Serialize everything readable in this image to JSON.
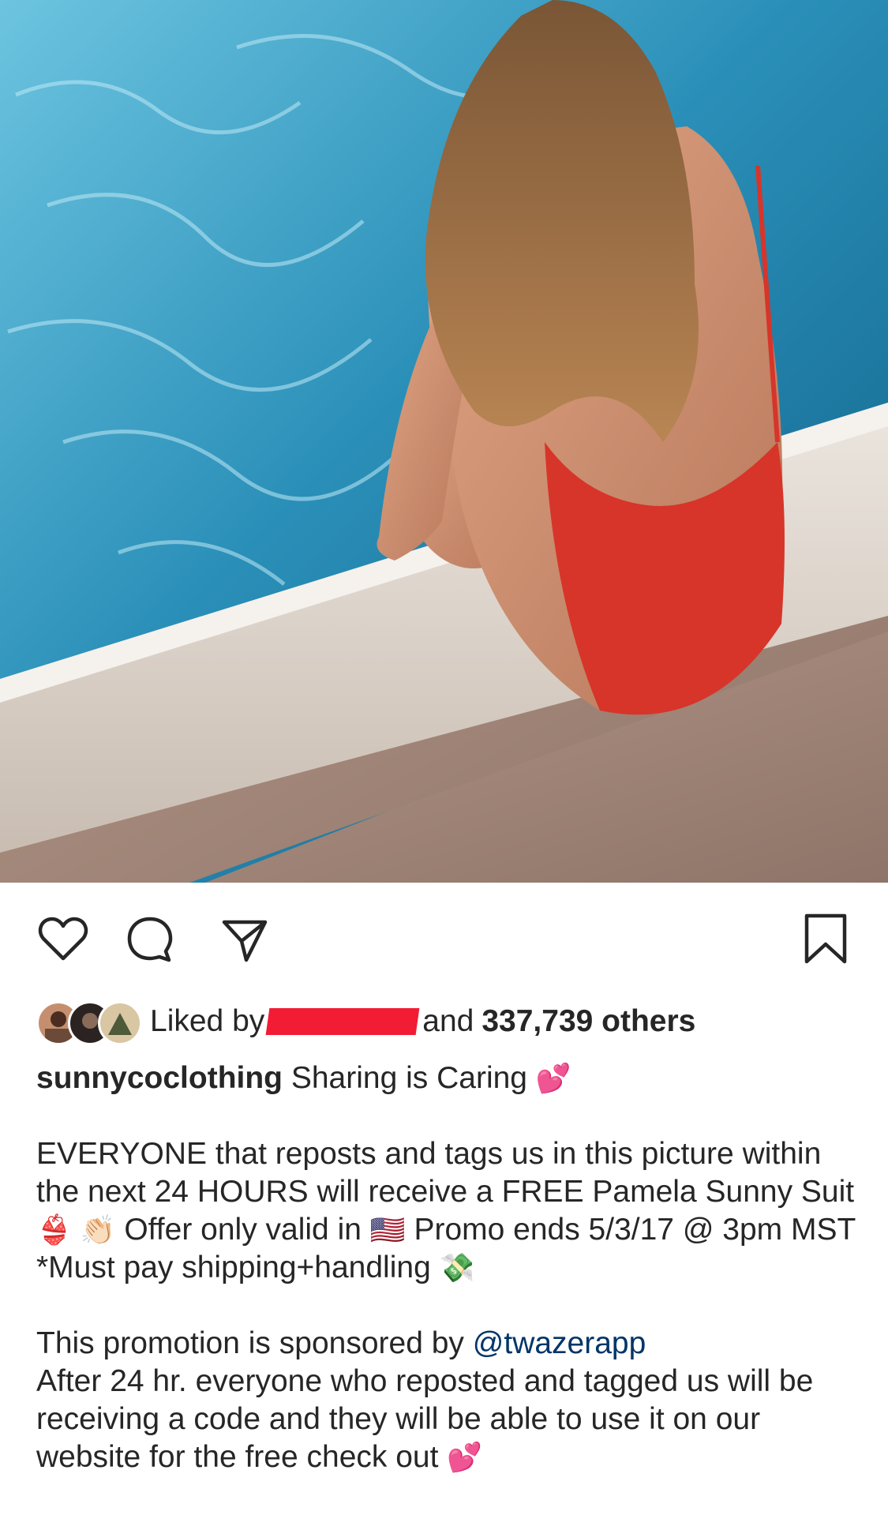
{
  "post": {
    "image_alt": "Woman in red swimsuit sitting at pool edge",
    "icons": {
      "like": "heart-icon",
      "comment": "comment-icon",
      "share": "paper-plane-icon",
      "save": "bookmark-icon"
    }
  },
  "likes": {
    "prefix": "Liked by",
    "middle": "and",
    "count": "337,739 others"
  },
  "caption": {
    "username": "sunnycoclothing",
    "line1": "Sharing is Caring",
    "emoji_heart": "💕",
    "para1_a": "EVERYONE that reposts and tags us in this picture within the next 24 HOURS will receive a FREE Pamela Sunny Suit",
    "emoji_bikini": "👙",
    "emoji_clap": "👏🏻",
    "para1_b": "Offer only valid in",
    "emoji_flag": "🇺🇸",
    "para1_c": "Promo ends 5/3/17 @ 3pm MST *Must pay shipping+handling",
    "emoji_money": "💸",
    "para2_a": "This promotion is sponsored by",
    "mention": "@twazerapp",
    "para2_b": "After 24 hr. everyone who reposted and tagged us will be receiving a code and they will be able to use it on our website for the free check out",
    "emoji_heart2": "💕"
  },
  "colors": {
    "text": "#262626",
    "mention": "#003569",
    "redaction": "#f21c35"
  }
}
